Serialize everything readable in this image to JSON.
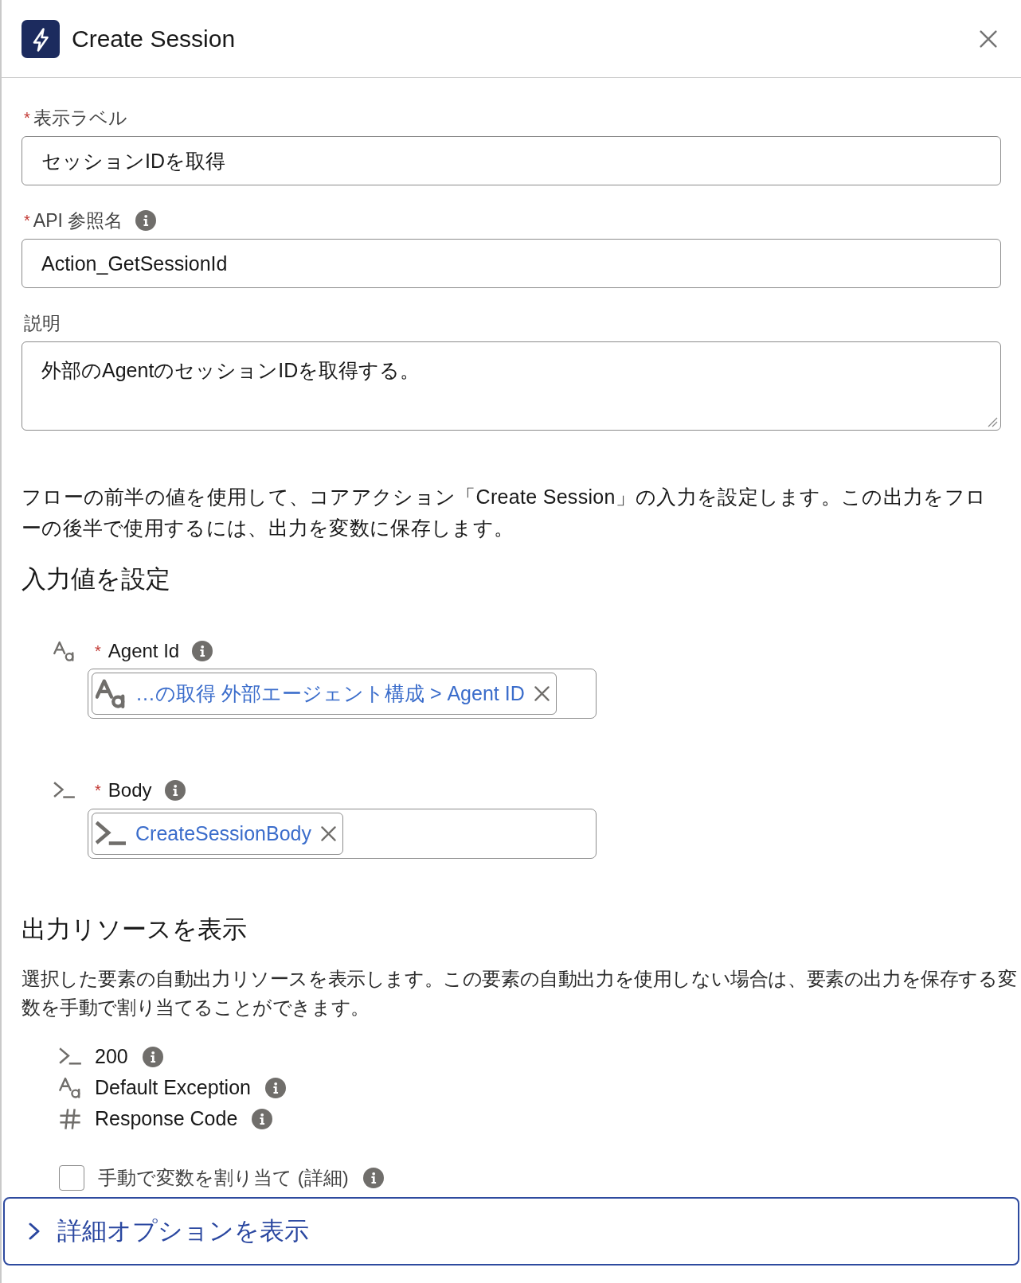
{
  "header": {
    "title": "Create Session"
  },
  "fields": [
    {
      "kind": "input",
      "required_mark": "*",
      "label": "表示ラベル",
      "value": "セッションIDを取得"
    },
    {
      "kind": "input",
      "required_mark": "*",
      "label": "API 参照名",
      "info": true,
      "value": "Action_GetSessionId"
    },
    {
      "kind": "textarea",
      "label": "説明",
      "value": "外部のAgentのセッションIDを取得する。"
    }
  ],
  "intro": "フローの前半の値を使用して、コアアクション「Create Session」の入力を設定します。この出力をフローの後半で使用するには、出力を変数に保存します。",
  "input_values": {
    "heading": "入力値を設定",
    "parameters": [
      {
        "kind": "text",
        "required_mark": "*",
        "label": "Agent Id",
        "info": true,
        "resource": {
          "kind": "text",
          "value": "…の取得 外部エージェント構成 > Agent ID"
        }
      },
      {
        "kind": "apex",
        "required_mark": "*",
        "label": "Body",
        "info": true,
        "resource": {
          "kind": "apex",
          "value": "CreateSessionBody"
        }
      }
    ]
  },
  "output_resources": {
    "heading": "出力リソースを表示",
    "description": "選択した要素の自動出力リソースを表示します。この要素の自動出力を使用しない場合は、要素の出力を保存する変数を手動で割り当てることができます。",
    "items": [
      {
        "kind": "apex",
        "label": "200",
        "info": true
      },
      {
        "kind": "text",
        "label": "Default Exception",
        "info": true
      },
      {
        "kind": "number",
        "label": "Response Code",
        "info": true
      }
    ],
    "manual_assign": {
      "label": "手動で変数を割り当て (詳細)",
      "checked": false,
      "info": true
    }
  },
  "advanced": {
    "label": "詳細オプションを表示",
    "expanded": false
  }
}
